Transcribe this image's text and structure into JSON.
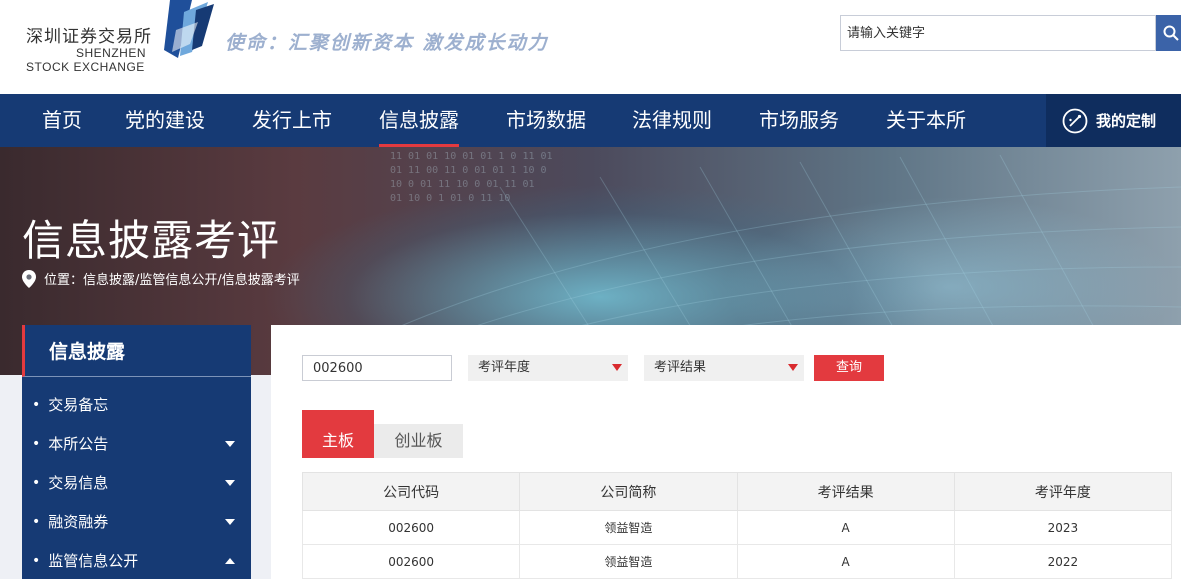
{
  "header": {
    "logo_cn": "深圳证券交易所",
    "logo_en_line1": "SHENZHEN",
    "logo_en_line2": "STOCK EXCHANGE",
    "slogan": "使命：汇聚创新资本 激发成长动力",
    "search_placeholder": "请输入关键字",
    "colors": {
      "nav_bg": "#163a74",
      "accent_red": "#e33a3f",
      "search_btn": "#3b63a8"
    }
  },
  "nav": {
    "items": [
      {
        "label": "首页",
        "active": false
      },
      {
        "label": "党的建设",
        "active": false
      },
      {
        "label": "发行上市",
        "active": false
      },
      {
        "label": "信息披露",
        "active": true
      },
      {
        "label": "市场数据",
        "active": false
      },
      {
        "label": "法律规则",
        "active": false
      },
      {
        "label": "市场服务",
        "active": false
      },
      {
        "label": "关于本所",
        "active": false
      }
    ],
    "custom_label": "我的定制",
    "custom_icon": "customize-icon"
  },
  "banner": {
    "title": "信息披露考评",
    "breadcrumb": "位置：信息披露/监管信息公开/信息披露考评"
  },
  "sidebar": {
    "title": "信息披露",
    "items": [
      {
        "label": "交易备忘",
        "arrow": ""
      },
      {
        "label": "本所公告",
        "arrow": "down"
      },
      {
        "label": "交易信息",
        "arrow": "down"
      },
      {
        "label": "融资融券",
        "arrow": "down"
      },
      {
        "label": "监管信息公开",
        "arrow": "up"
      }
    ]
  },
  "filters": {
    "code_value": "002600",
    "year_label": "考评年度",
    "result_label": "考评结果",
    "query_label": "查询"
  },
  "tabs": {
    "main": "主板",
    "chinext": "创业板"
  },
  "table": {
    "headers": [
      "公司代码",
      "公司简称",
      "考评结果",
      "考评年度"
    ],
    "rows": [
      [
        "002600",
        "领益智造",
        "A",
        "2023"
      ],
      [
        "002600",
        "领益智造",
        "A",
        "2022"
      ]
    ]
  }
}
